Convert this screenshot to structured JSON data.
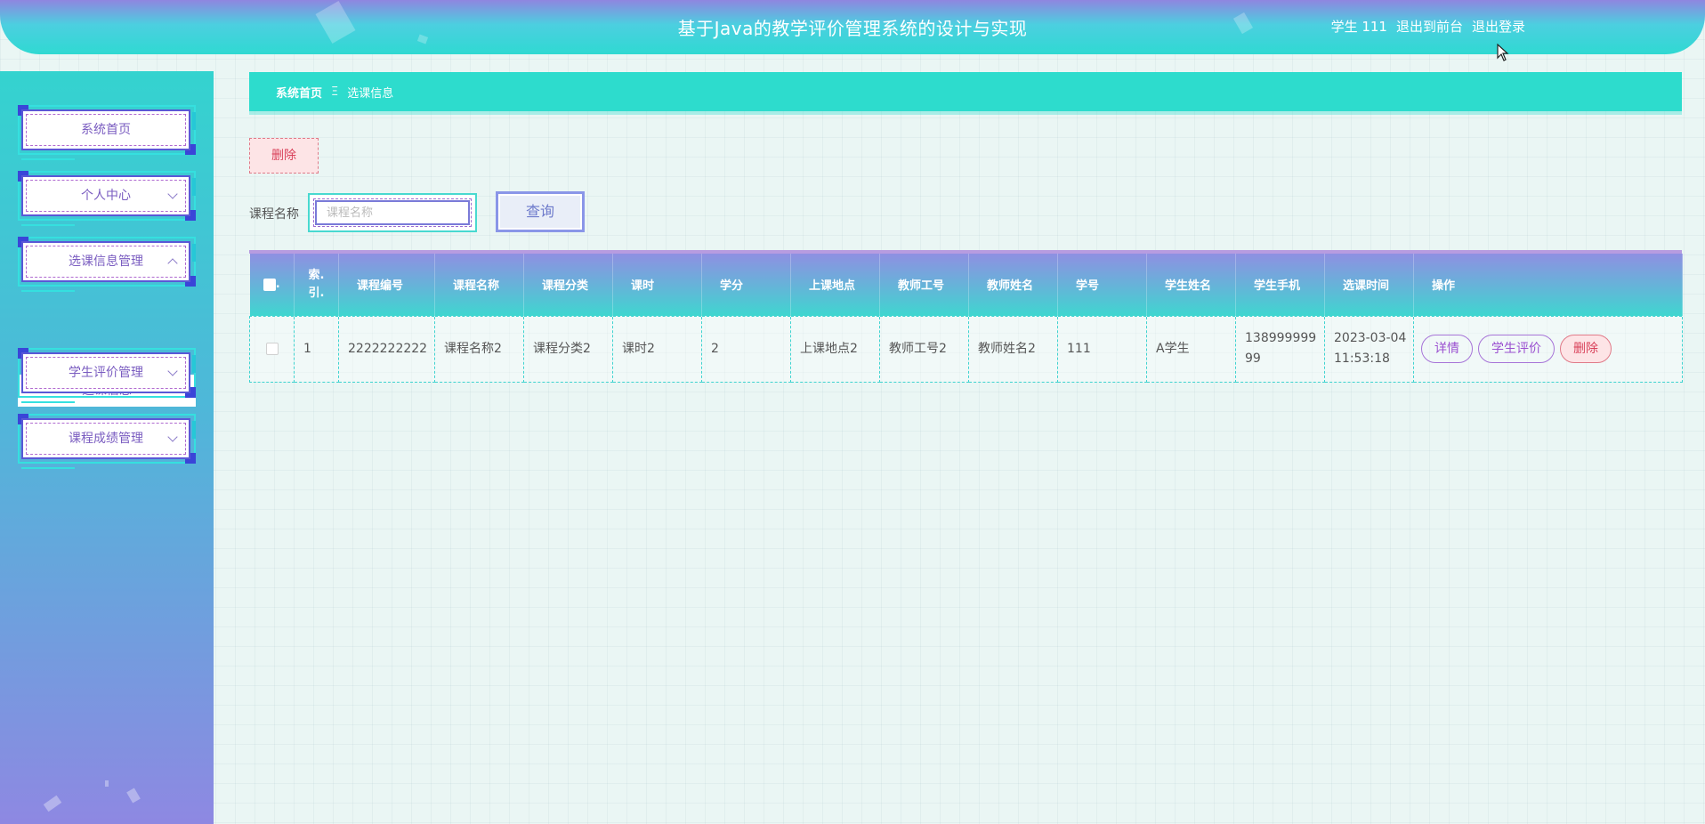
{
  "header": {
    "title": "基于Java的教学评价管理系统的设计与实现",
    "user_label": "学生 111",
    "to_frontend": "退出到前台",
    "logout": "退出登录"
  },
  "sidebar": {
    "items": [
      {
        "label": "系统首页"
      },
      {
        "label": "个人中心"
      },
      {
        "label": "选课信息管理"
      },
      {
        "label": "学生评价管理"
      },
      {
        "label": "课程成绩管理"
      }
    ],
    "submenu": [
      {
        "label": "选课信息"
      }
    ]
  },
  "breadcrumb": {
    "home": "系统首页",
    "separator": "Ξ",
    "current": "选课信息"
  },
  "toolbar": {
    "delete_label": "删除",
    "search_label": "课程名称",
    "search_placeholder": "课程名称",
    "search_button": "查询"
  },
  "table": {
    "columns": [
      "",
      "索引",
      "课程编号",
      "课程名称",
      "课程分类",
      "课时",
      "学分",
      "上课地点",
      "教师工号",
      "教师姓名",
      "学号",
      "学生姓名",
      "学生手机",
      "选课时间",
      "操作"
    ],
    "index_header_top": "索.",
    "index_header_bottom": "引.",
    "rows": [
      {
        "index": "1",
        "course_no": "2222222222",
        "course_name": "课程名称2",
        "course_category": "课程分类2",
        "hours": "课时2",
        "credit": "2",
        "location": "上课地点2",
        "teacher_no": "教师工号2",
        "teacher_name": "教师姓名2",
        "student_no": "111",
        "student_name": "A学生",
        "student_phone": "13899999999",
        "select_time": "2023-03-04 11:53:18",
        "actions": {
          "detail": "详情",
          "evaluate": "学生评价",
          "delete": "删除"
        }
      }
    ]
  },
  "colors": {
    "accent_teal": "#2ddccd",
    "accent_purple": "#8f86e0",
    "danger": "#d9415a"
  }
}
